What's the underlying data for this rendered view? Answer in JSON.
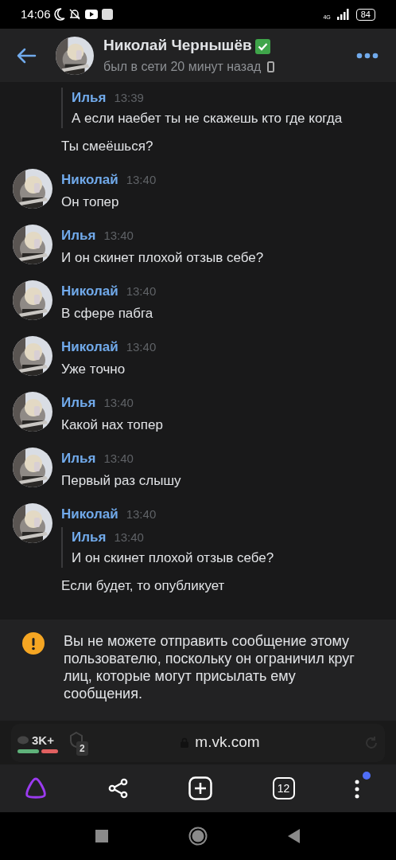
{
  "status_bar": {
    "time": "14:06",
    "network": "4G",
    "battery": "84"
  },
  "header": {
    "name": "Николай Чернышёв",
    "verified": true,
    "status": "был в сети 20 минут назад"
  },
  "messages": [
    {
      "quote": {
        "author": "Илья",
        "time": "13:39",
        "text": "А если наебет ты не скажешь кто где когда"
      },
      "text": "Ты смеёшься?"
    },
    {
      "author": "Николай",
      "time": "13:40",
      "text": "Он топер"
    },
    {
      "author": "Илья",
      "time": "13:40",
      "text": "И он скинет плохой отзыв себе?"
    },
    {
      "author": "Николай",
      "time": "13:40",
      "text": "В сфере пабга"
    },
    {
      "author": "Николай",
      "time": "13:40",
      "text": "Уже точно"
    },
    {
      "author": "Илья",
      "time": "13:40",
      "text": "Какой нах топер"
    },
    {
      "author": "Илья",
      "time": "13:40",
      "text": "Первый раз слышу"
    },
    {
      "author": "Николай",
      "time": "13:40",
      "quote": {
        "author": "Илья",
        "time": "13:40",
        "text": "И он скинет плохой отзыв себе?"
      },
      "text": "Если будет, то опубликует"
    }
  ],
  "notice": "Вы не можете отправить сообщение этому пользователю, поскольку он ограничил круг лиц, которые могут присылать ему сообщения.",
  "browser": {
    "comments": "3K+",
    "shield_count": "2",
    "url": "m.vk.com",
    "tab_count": "12",
    "menu_notification": true
  }
}
